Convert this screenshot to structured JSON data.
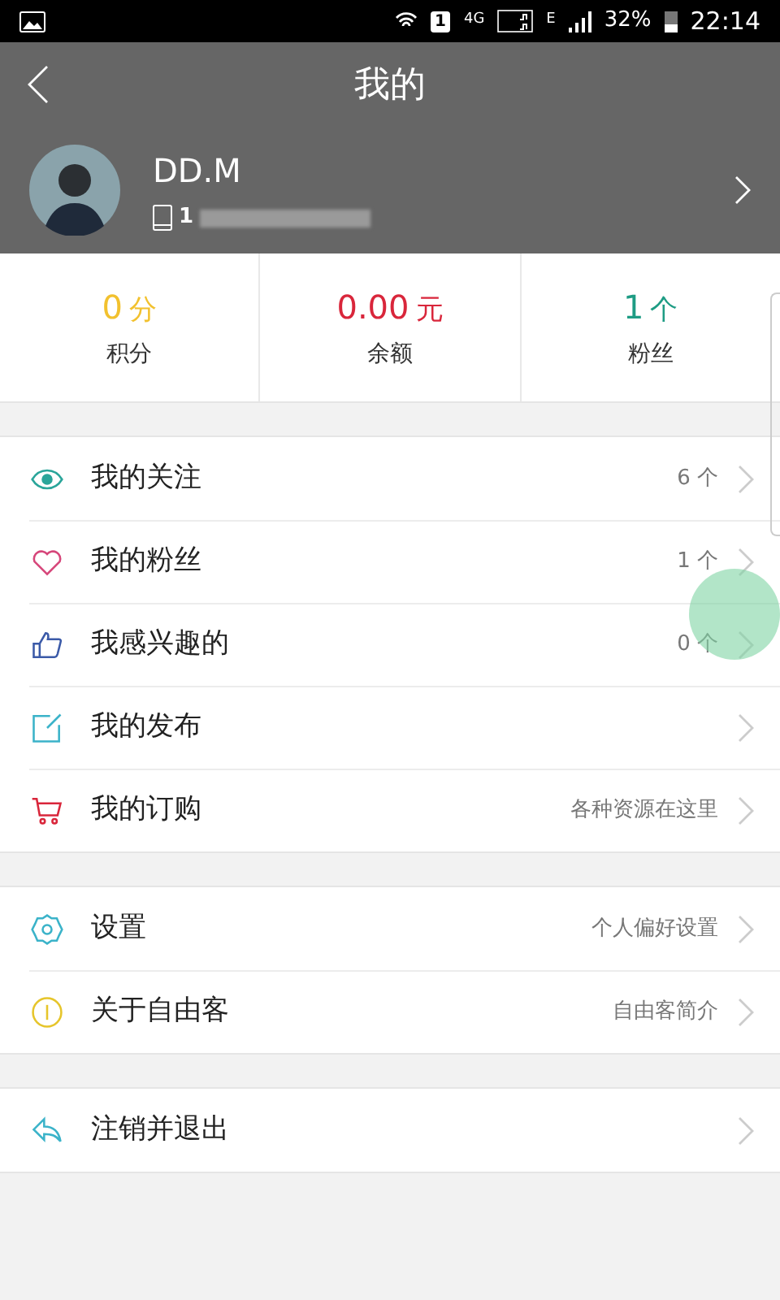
{
  "status_bar": {
    "sim": "1",
    "network": "4G",
    "network_2": "E",
    "battery": "32%",
    "time": "22:14"
  },
  "header": {
    "title": "我的"
  },
  "profile": {
    "name": "DD.M",
    "phone": "1"
  },
  "stats": [
    {
      "value": "0",
      "unit": "分",
      "label": "积分",
      "color": "#f2c12e"
    },
    {
      "value": "0.00",
      "unit": "元",
      "label": "余额",
      "color": "#d9263b"
    },
    {
      "value": "1",
      "unit": "个",
      "label": "粉丝",
      "color": "#1e9c84"
    }
  ],
  "groups": [
    [
      {
        "kind": "eye",
        "label": "我的关注",
        "detail": "6 个"
      },
      {
        "kind": "heart",
        "label": "我的粉丝",
        "detail": "1 个"
      },
      {
        "kind": "thumb",
        "label": "我感兴趣的",
        "detail": "0 个"
      },
      {
        "kind": "edit",
        "label": "我的发布"
      },
      {
        "kind": "cart",
        "label": "我的订购",
        "detail": "各种资源在这里"
      }
    ],
    [
      {
        "kind": "gear",
        "label": "设置",
        "detail": "个人偏好设置"
      },
      {
        "kind": "info",
        "label": "关于自由客",
        "detail": "自由客简介"
      }
    ],
    [
      {
        "kind": "logout",
        "label": "注销并退出"
      }
    ]
  ]
}
